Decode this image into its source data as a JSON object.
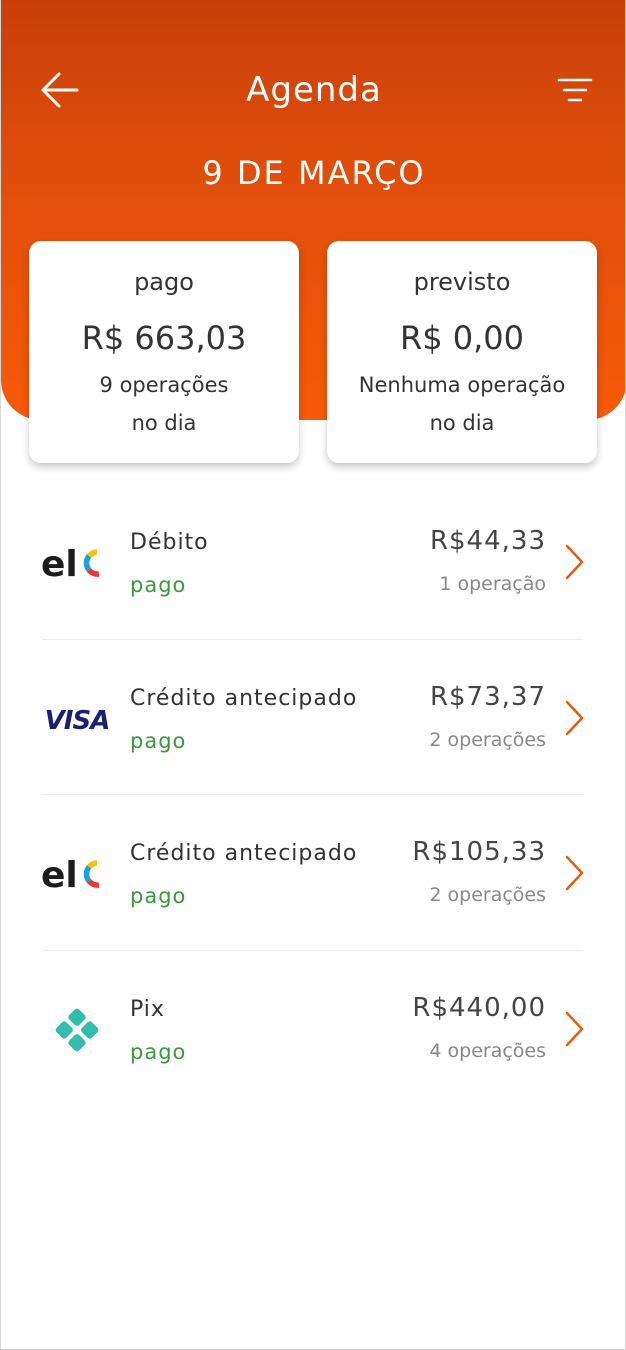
{
  "header": {
    "title": "Agenda",
    "date": "9 DE MARÇO",
    "back_icon": "arrow-left-icon",
    "filter_icon": "filter-icon",
    "color_top": "#c93f08",
    "color_bottom": "#f75a08"
  },
  "summary": {
    "paid": {
      "label": "pago",
      "amount": "R$ 663,03",
      "line1": "9 operações",
      "line2": "no dia"
    },
    "expected": {
      "label": "previsto",
      "amount": "R$ 0,00",
      "line1": "Nenhuma operação",
      "line2": "no dia"
    }
  },
  "transactions": [
    {
      "brand": "elo",
      "logo_icon": "elo-logo-icon",
      "name": "Débito",
      "status": "pago",
      "amount": "R$44,33",
      "operations": "1 operação"
    },
    {
      "brand": "VISA",
      "logo_icon": "visa-logo-icon",
      "name": "Crédito antecipado",
      "status": "pago",
      "amount": "R$73,37",
      "operations": "2 operações"
    },
    {
      "brand": "elo",
      "logo_icon": "elo-logo-icon",
      "name": "Crédito antecipado",
      "status": "pago",
      "amount": "R$105,33",
      "operations": "2 operações"
    },
    {
      "brand": "Pix",
      "logo_icon": "pix-logo-icon",
      "name": "Pix",
      "status": "pago",
      "amount": "R$440,00",
      "operations": "4 operações"
    }
  ],
  "colors": {
    "accent": "#e8590c",
    "status_paid": "#3a9a3a",
    "chevron": "#e8590c"
  }
}
